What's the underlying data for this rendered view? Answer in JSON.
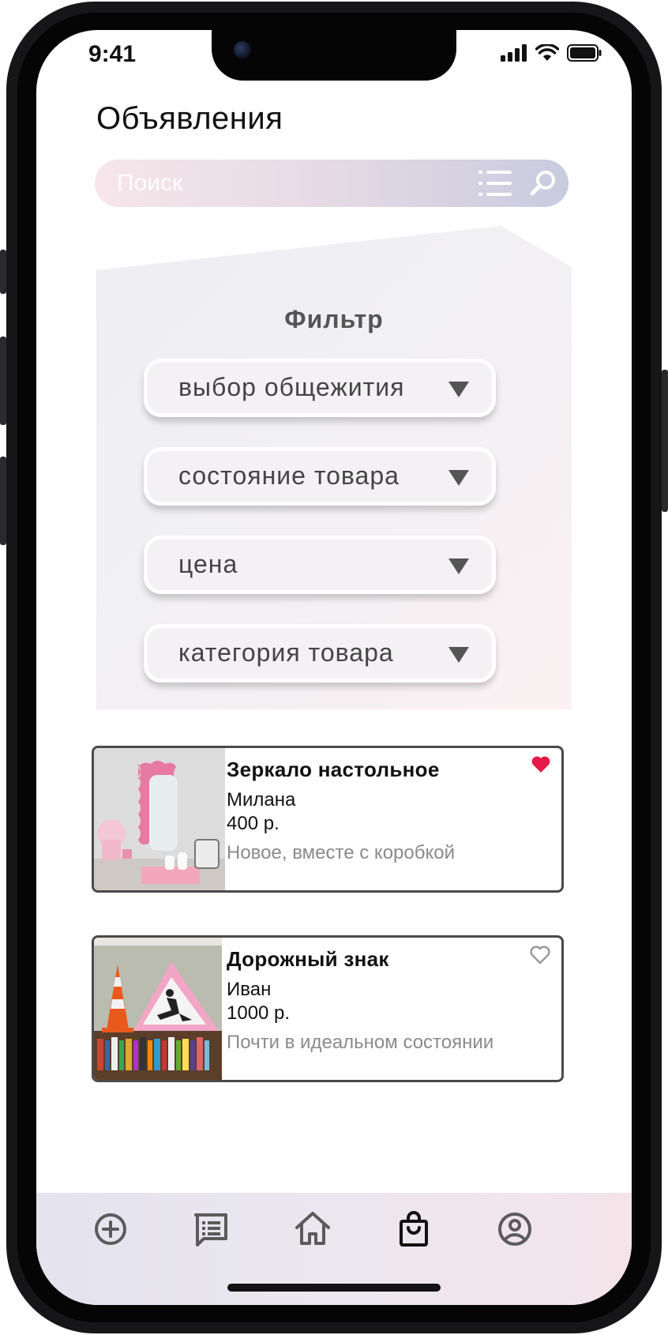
{
  "status_bar": {
    "time": "9:41"
  },
  "header": {
    "title": "Объявления"
  },
  "search": {
    "placeholder": "Поиск"
  },
  "filter": {
    "title": "Фильтр",
    "dropdowns": [
      {
        "label": "выбор общежития"
      },
      {
        "label": "состояние товара"
      },
      {
        "label": "цена"
      },
      {
        "label": "категория товара"
      }
    ]
  },
  "listings": [
    {
      "title": "Зеркало настольное",
      "seller": "Милана",
      "price": "400 р.",
      "description": "Новое, вместе с коробкой",
      "favorited": true,
      "image_icon": "mirror-photo"
    },
    {
      "title": "Дорожный знак",
      "seller": "Иван",
      "price": "1000 р.",
      "description": "Почти в идеальном состоянии",
      "favorited": false,
      "image_icon": "road-sign-photo"
    }
  ],
  "tabbar": {
    "items": [
      {
        "icon": "plus-circle-icon"
      },
      {
        "icon": "messages-icon"
      },
      {
        "icon": "home-icon"
      },
      {
        "icon": "shopping-bag-icon",
        "active": true
      },
      {
        "icon": "profile-icon"
      }
    ]
  },
  "colors": {
    "accent_heart": "#e8194a",
    "search_gradient_start": "#f6e6ea",
    "search_gradient_end": "#c9cbdf",
    "text_primary": "#111111",
    "text_secondary": "#8a8a8a"
  }
}
